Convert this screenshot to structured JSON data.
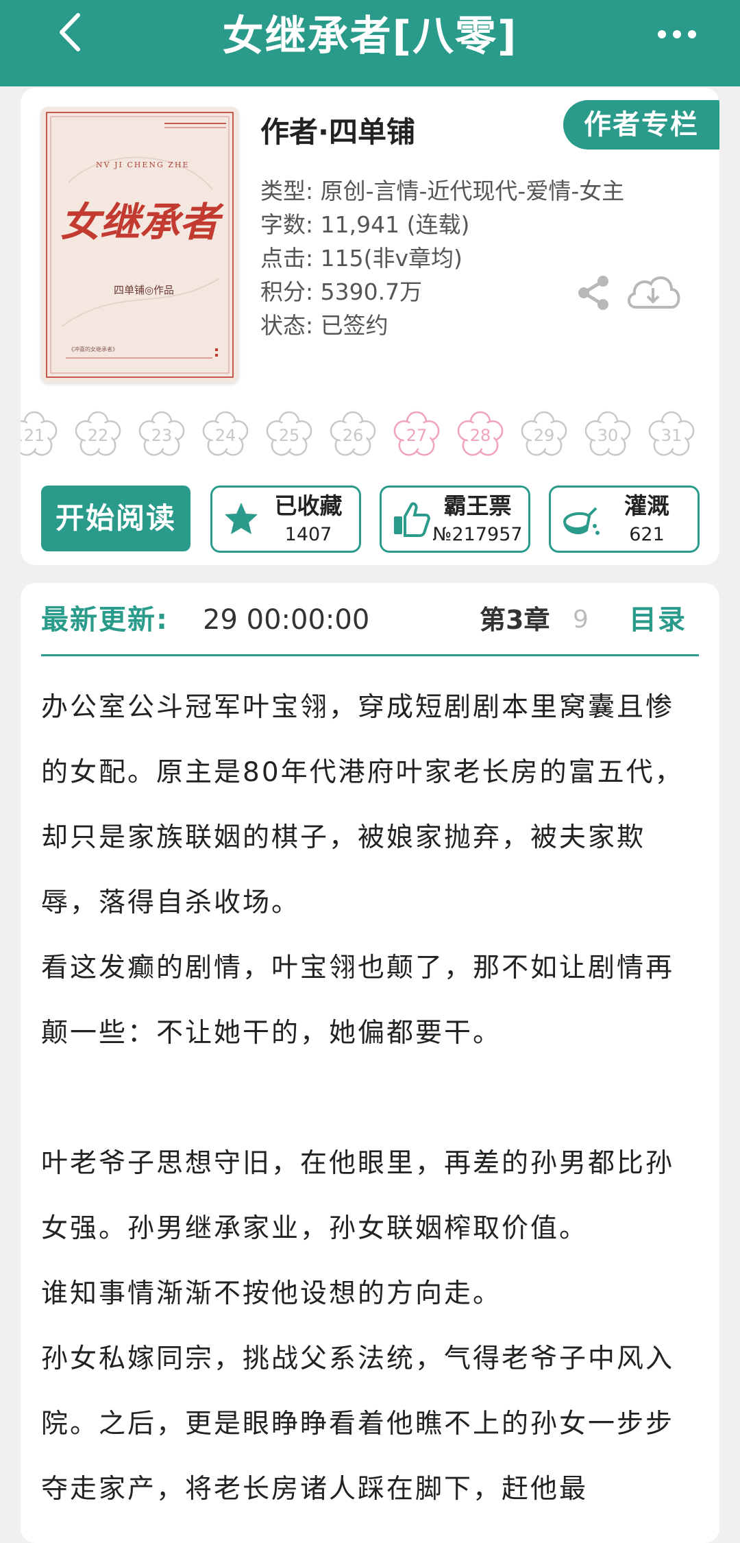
{
  "header": {
    "title": "女继承者[八零]"
  },
  "book": {
    "author_line": "作者·四单铺",
    "author_column_label": "作者专栏",
    "meta": [
      "类型: 原创-言情-近代现代-爱情-女主",
      "字数: 11,941 (连载)",
      "点击: 115(非v章均)",
      "积分: 5390.7万",
      "状态: 已签约"
    ],
    "cover": {
      "pinyin": "NV JI CHENG ZHE",
      "title": "女继承者",
      "author_credit": "四单铺◎作品",
      "small_text": "《冲喜的女继承者》"
    }
  },
  "days": [
    "21",
    "22",
    "23",
    "24",
    "25",
    "26",
    "27",
    "28",
    "29",
    "30",
    "31"
  ],
  "highlight_days": [
    "27",
    "28"
  ],
  "actions": {
    "read_label": "开始阅读",
    "favorite": {
      "label": "已收藏",
      "count": "1407"
    },
    "ticket": {
      "label": "霸王票",
      "count": "№217957"
    },
    "water": {
      "label": "灌溉",
      "count": "621"
    }
  },
  "update": {
    "label": "最新更新:",
    "time": "29 00:00:00",
    "chapter": "第3章",
    "chapter_cut": "9",
    "toc_label": "目录"
  },
  "synopsis": [
    "办公室公斗冠军叶宝翎，穿成短剧剧本里窝囊且惨的女配。原主是80年代港府叶家老长房的富五代，却只是家族联姻的棋子，被娘家抛弃，被夫家欺辱，落得自杀收场。",
    "看这发癫的剧情，叶宝翎也颠了，那不如让剧情再颠一些：不让她干的，她偏都要干。",
    "",
    "叶老爷子思想守旧，在他眼里，再差的孙男都比孙女强。孙男继承家业，孙女联姻榨取价值。",
    "谁知事情渐渐不按他设想的方向走。",
    "孙女私嫁同宗，挑战父系法统，气得老爷子中风入院。之后，更是眼睁睁看着他瞧不上的孙女一步步夺走家产，将老长房诸人踩在脚下，赶他最"
  ],
  "colors": {
    "accent": "#2a9b8a",
    "flower_pink": "#f0a2b8",
    "flower_gray": "#c8c8c8"
  }
}
